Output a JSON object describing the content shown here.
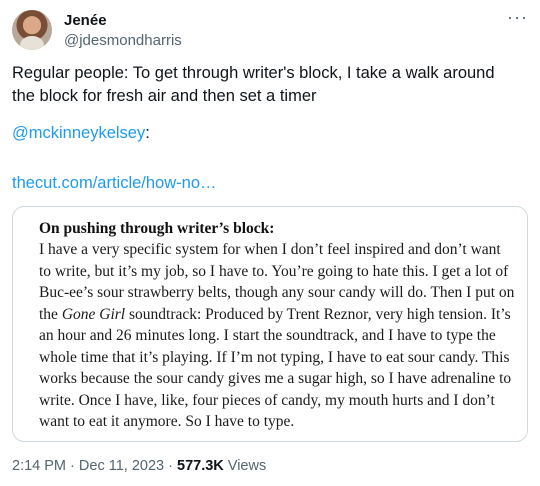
{
  "author": {
    "name": "Jenée",
    "handle": "@jdesmondharris"
  },
  "tweet": {
    "text": "Regular people: To get through writer's block, I take a walk around the block for fresh air and then set a timer",
    "mention": "@mckinneykelsey",
    "mention_suffix": ":",
    "link": "thecut.com/article/how-no…"
  },
  "quote": {
    "title": "On pushing through writer’s block:",
    "body_part1": "I have a very specific system for when I don’t feel inspired and don’t want to write, but it’s my job, so I have to. You’re going to hate this. I get a lot of Buc-ee’s sour strawberry belts, though any sour candy will do. Then I put on the ",
    "body_italic": "Gone Girl",
    "body_part2": " soundtrack: Produced by Trent Reznor, very high tension. It’s an hour and 26 minutes long. I start the soundtrack, and I have to type the whole time that it’s playing. If I’m not typing, I have to eat sour candy. This works because the sour candy gives me a sugar high, so I have adrenaline to write. Once I have, like, four pieces of candy, my mouth hurts and I don’t want to eat it anymore. So I have to type."
  },
  "meta": {
    "time": "2:14 PM",
    "separator": "·",
    "date": "Dec 11, 2023",
    "views_count": "577.3K",
    "views_label": "Views"
  },
  "icons": {
    "more": "more-horizontal-icon"
  },
  "colors": {
    "accent": "#1d9bf0",
    "secondary_text": "#536471",
    "border": "#cfd9de"
  }
}
